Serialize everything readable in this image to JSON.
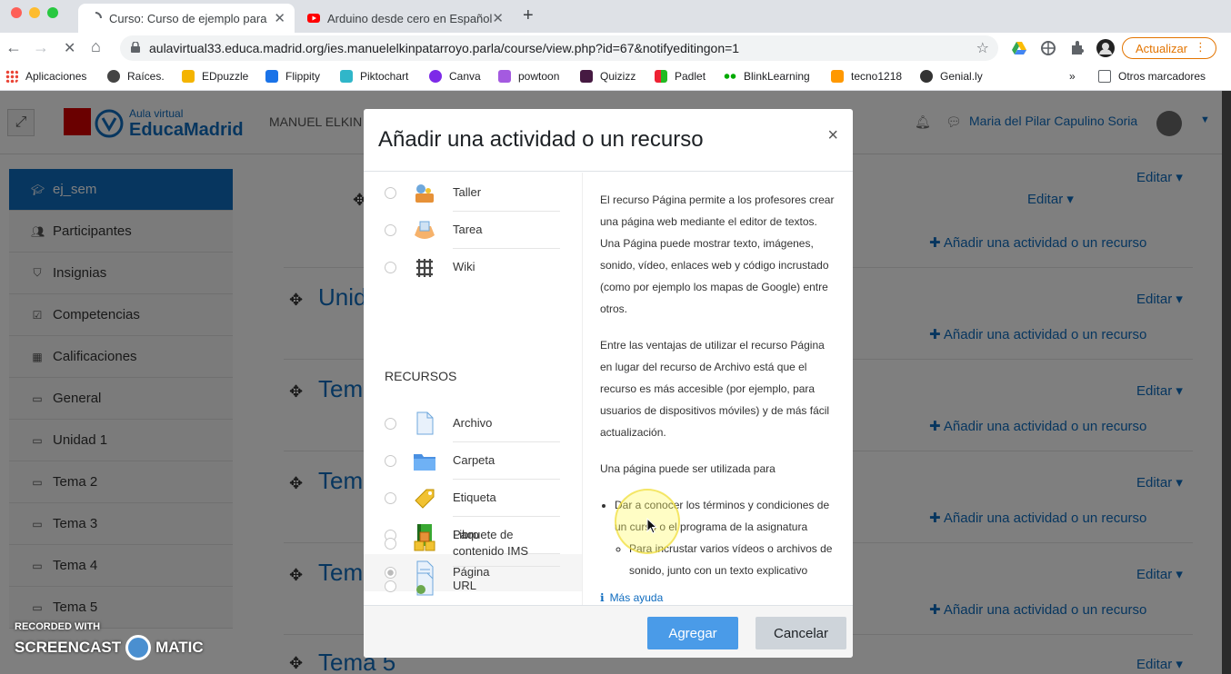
{
  "browser": {
    "tabs": [
      {
        "title": "Curso: Curso de ejemplo para",
        "active": true
      },
      {
        "title": "Arduino desde cero en Español",
        "active": false
      }
    ],
    "url": "aulavirtual33.educa.madrid.org/ies.manuelelkinpatarroyo.parla/course/view.php?id=67&notifyeditingon=1",
    "update_label": "Actualizar",
    "bookmarks": [
      "Aplicaciones",
      "Raíces.",
      "EDpuzzle",
      "Flippity",
      "Piktochart",
      "Canva",
      "powtoon",
      "Quizizz",
      "Padlet",
      "BlinkLearning",
      "tecno1218",
      "Genial.ly"
    ],
    "more_bookmarks": "»",
    "other_bookmarks": "Otros marcadores"
  },
  "moodle": {
    "logo_line1": "Aula virtual",
    "logo_line2": "EducaMadrid",
    "course_name": "MANUEL ELKIN",
    "user_name": "Maria del Pilar Capulino Soria",
    "sidebar": [
      {
        "label": "ej_sem",
        "icon": "graduation-cap-icon",
        "active": true
      },
      {
        "label": "Participantes",
        "icon": "users-icon",
        "active": false
      },
      {
        "label": "Insignias",
        "icon": "shield-icon",
        "active": false
      },
      {
        "label": "Competencias",
        "icon": "check-square-icon",
        "active": false
      },
      {
        "label": "Calificaciones",
        "icon": "table-icon",
        "active": false
      },
      {
        "label": "General",
        "icon": "folder-icon",
        "active": false
      },
      {
        "label": "Unidad 1",
        "icon": "folder-icon",
        "active": false
      },
      {
        "label": "Tema 2",
        "icon": "folder-icon",
        "active": false
      },
      {
        "label": "Tema 3",
        "icon": "folder-icon",
        "active": false
      },
      {
        "label": "Tema 4",
        "icon": "folder-icon",
        "active": false
      },
      {
        "label": "Tema 5",
        "icon": "folder-icon",
        "active": false
      }
    ],
    "edit_label": "Editar",
    "add_activity_label": "Añadir una actividad o un recurso",
    "section_titles": [
      "Unid",
      "Tem",
      "Tem",
      "Tem",
      "Tema 5"
    ]
  },
  "screencast": {
    "line1": "RECORDED WITH",
    "line2": "SCREENCAST",
    "line3": "MATIC"
  },
  "modal": {
    "title": "Añadir una actividad o un recurso",
    "close": "×",
    "activities": [
      {
        "label": "Taller",
        "icon": "workshop-icon"
      },
      {
        "label": "Tarea",
        "icon": "assignment-icon"
      },
      {
        "label": "Wiki",
        "icon": "wiki-icon"
      }
    ],
    "resources_heading": "RECURSOS",
    "resources": [
      {
        "label": "Archivo",
        "icon": "file-icon",
        "selected": false
      },
      {
        "label": "Carpeta",
        "icon": "folder-icon",
        "selected": false
      },
      {
        "label": "Etiqueta",
        "icon": "label-icon",
        "selected": false
      },
      {
        "label": "Libro",
        "icon": "book-icon",
        "selected": false
      },
      {
        "label": "Página",
        "icon": "page-icon",
        "selected": true
      },
      {
        "label": "Paquete de contenido IMS",
        "icon": "ims-package-icon",
        "selected": false
      },
      {
        "label": "URL",
        "icon": "url-icon",
        "selected": false
      }
    ],
    "help": {
      "p1": "El recurso Página permite a los profesores crear una página web mediante el editor de textos. Una Página puede mostrar texto, imágenes, sonido, vídeo, enlaces web y código incrustado (como por ejemplo los mapas de Google) entre otros.",
      "p2": "Entre las ventajas de utilizar el recurso Página en lugar del recurso de Archivo está que el recurso es más accesible (por ejemplo, para usuarios de dispositivos móviles) y de más fácil actualización.",
      "p3": "Una página puede ser utilizada para",
      "li1": "Dar a conocer los términos y condiciones de un curso o el programa de la asignatura",
      "li2": "Para incrustar varios vídeos o archivos de sonido, junto con un texto explicativo",
      "more": "Más ayuda"
    },
    "add_button": "Agregar",
    "cancel_button": "Cancelar"
  }
}
